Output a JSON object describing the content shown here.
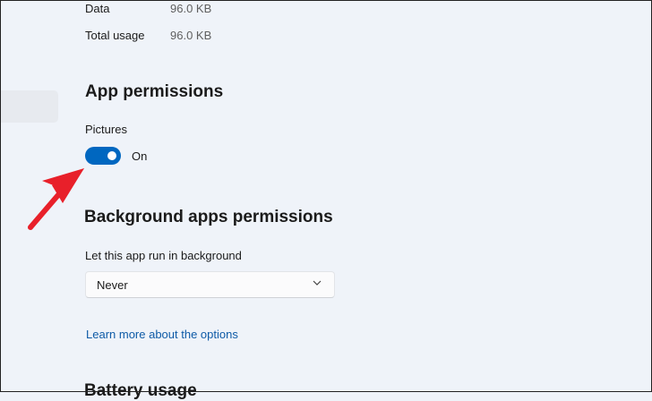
{
  "usage": {
    "rows": [
      {
        "label": "Data",
        "value": "96.0 KB"
      },
      {
        "label": "Total usage",
        "value": "96.0 KB"
      }
    ]
  },
  "app_permissions": {
    "heading": "App permissions",
    "pictures_label": "Pictures",
    "toggle_state": "On"
  },
  "background": {
    "heading": "Background apps permissions",
    "label": "Let this app run in background",
    "selected": "Never",
    "learn_more": "Learn more about the options"
  },
  "battery": {
    "heading": "Battery usage"
  },
  "colors": {
    "accent": "#0067c0",
    "arrow": "#e8202a",
    "link": "#0f5ba7"
  }
}
